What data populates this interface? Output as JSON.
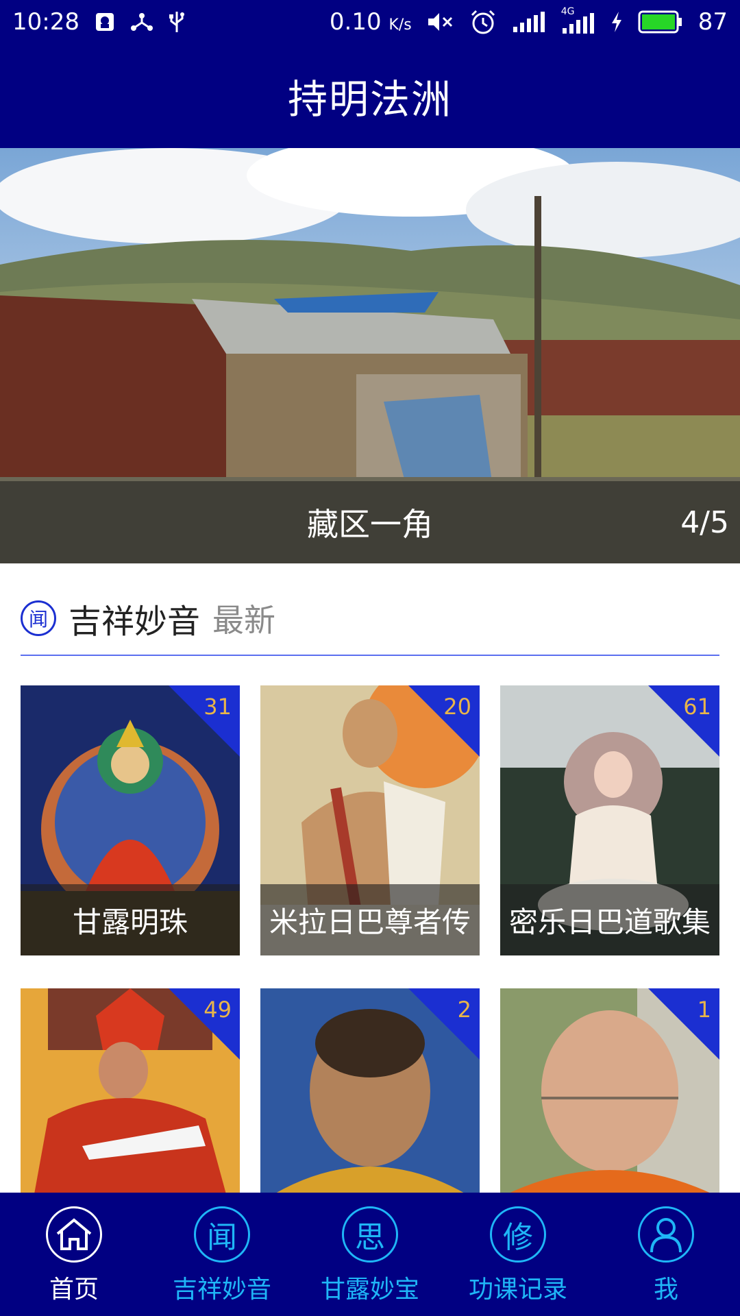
{
  "status_bar": {
    "time": "10:28",
    "speed": "0.10",
    "speed_unit": "K/s",
    "battery": "87",
    "network": "4G"
  },
  "header": {
    "title": "持明法洲"
  },
  "banner": {
    "caption": "藏区一角",
    "index": "4/5"
  },
  "section": {
    "icon_char": "闻",
    "title": "吉祥妙音",
    "subtitle": "最新"
  },
  "cards": [
    {
      "count": "31",
      "title": "甘露明珠"
    },
    {
      "count": "20",
      "title": "米拉日巴尊者传"
    },
    {
      "count": "61",
      "title": "密乐日巴道歌集"
    },
    {
      "count": "49",
      "title": ""
    },
    {
      "count": "2",
      "title": ""
    },
    {
      "count": "1",
      "title": ""
    }
  ],
  "tabs": [
    {
      "label": "首页",
      "icon": "home-icon"
    },
    {
      "label": "吉祥妙音",
      "icon_char": "闻"
    },
    {
      "label": "甘露妙宝",
      "icon_char": "思"
    },
    {
      "label": "功课记录",
      "icon_char": "修"
    },
    {
      "label": "我",
      "icon": "user-icon"
    }
  ],
  "colors": {
    "primary": "#010082",
    "accent_blue": "#1b2fd1",
    "tab_inactive": "#1fb6f7",
    "count_text": "#e8b54a"
  }
}
